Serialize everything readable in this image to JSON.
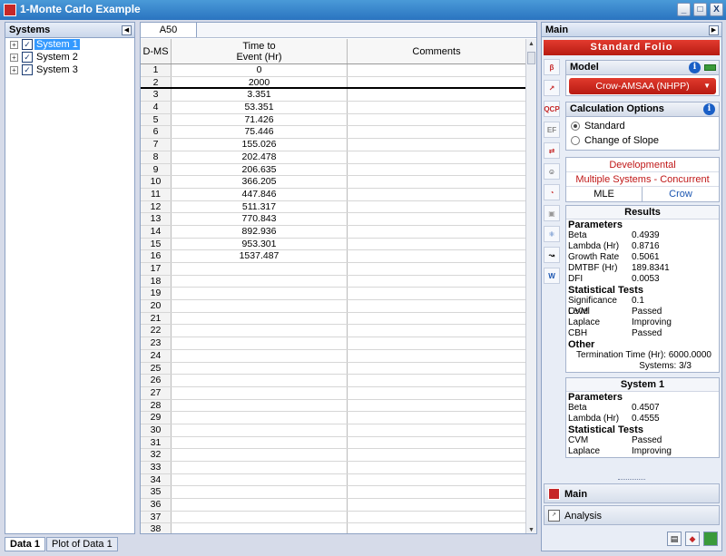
{
  "window": {
    "title": "1-Monte Carlo Example",
    "minimize": "_",
    "maximize": "□",
    "close": "X"
  },
  "systems_panel": {
    "title": "Systems",
    "items": [
      {
        "label": "System 1",
        "selected": true
      },
      {
        "label": "System 2",
        "selected": false
      },
      {
        "label": "System 3",
        "selected": false
      }
    ]
  },
  "sheet": {
    "cell_ref": "A50",
    "columns": [
      "D-MS",
      "Time to\nEvent (Hr)",
      "Comments"
    ],
    "rows": [
      [
        "1",
        "0",
        ""
      ],
      [
        "2",
        "2000",
        ""
      ],
      [
        "3",
        "3.351",
        ""
      ],
      [
        "4",
        "53.351",
        ""
      ],
      [
        "5",
        "71.426",
        ""
      ],
      [
        "6",
        "75.446",
        ""
      ],
      [
        "7",
        "155.026",
        ""
      ],
      [
        "8",
        "202.478",
        ""
      ],
      [
        "9",
        "206.635",
        ""
      ],
      [
        "10",
        "366.205",
        ""
      ],
      [
        "11",
        "447.846",
        ""
      ],
      [
        "12",
        "511.317",
        ""
      ],
      [
        "13",
        "770.843",
        ""
      ],
      [
        "14",
        "892.936",
        ""
      ],
      [
        "15",
        "953.301",
        ""
      ],
      [
        "16",
        "1537.487",
        ""
      ],
      [
        "17",
        "",
        ""
      ],
      [
        "18",
        "",
        ""
      ],
      [
        "19",
        "",
        ""
      ],
      [
        "20",
        "",
        ""
      ],
      [
        "21",
        "",
        ""
      ],
      [
        "22",
        "",
        ""
      ],
      [
        "23",
        "",
        ""
      ],
      [
        "24",
        "",
        ""
      ],
      [
        "25",
        "",
        ""
      ],
      [
        "26",
        "",
        ""
      ],
      [
        "27",
        "",
        ""
      ],
      [
        "28",
        "",
        ""
      ],
      [
        "29",
        "",
        ""
      ],
      [
        "30",
        "",
        ""
      ],
      [
        "31",
        "",
        ""
      ],
      [
        "32",
        "",
        ""
      ],
      [
        "33",
        "",
        ""
      ],
      [
        "34",
        "",
        ""
      ],
      [
        "35",
        "",
        ""
      ],
      [
        "36",
        "",
        ""
      ],
      [
        "37",
        "",
        ""
      ],
      [
        "38",
        "",
        ""
      ]
    ]
  },
  "bottom_tabs": [
    "Data 1",
    "Plot of Data 1"
  ],
  "right_panel": {
    "header": "Main",
    "folio_title": "Standard Folio",
    "model": {
      "title": "Model",
      "value": "Crow-AMSAA (NHPP)"
    },
    "calc_options": {
      "title": "Calculation Options",
      "options": [
        "Standard",
        "Change of Slope"
      ],
      "selected": 0
    },
    "info": {
      "line1": "Developmental",
      "line2": "Multiple Systems - Concurrent",
      "method": "MLE",
      "model": "Crow"
    },
    "results": {
      "title": "Results",
      "parameters_label": "Parameters",
      "parameters": [
        {
          "k": "Beta",
          "v": "0.4939"
        },
        {
          "k": "Lambda (Hr)",
          "v": "0.8716"
        },
        {
          "k": "Growth Rate",
          "v": "0.5061"
        },
        {
          "k": "DMTBF (Hr)",
          "v": "189.8341"
        },
        {
          "k": "DFI",
          "v": "0.0053"
        }
      ],
      "tests_label": "Statistical Tests",
      "tests": [
        {
          "k": "Significance Level",
          "v": "0.1"
        },
        {
          "k": "CVM",
          "v": "Passed"
        },
        {
          "k": "Laplace",
          "v": "Improving"
        },
        {
          "k": "CBH",
          "v": "Passed"
        }
      ],
      "other_label": "Other",
      "termination": "Termination Time (Hr): 6000.0000",
      "systems": "Systems: 3/3"
    },
    "system1": {
      "title": "System 1",
      "parameters_label": "Parameters",
      "parameters": [
        {
          "k": "Beta",
          "v": "0.4507"
        },
        {
          "k": "Lambda (Hr)",
          "v": "0.4555"
        }
      ],
      "tests_label": "Statistical Tests",
      "tests": [
        {
          "k": "CVM",
          "v": "Passed"
        },
        {
          "k": "Laplace",
          "v": "Improving"
        }
      ]
    },
    "nav": [
      "Main",
      "Analysis"
    ]
  }
}
